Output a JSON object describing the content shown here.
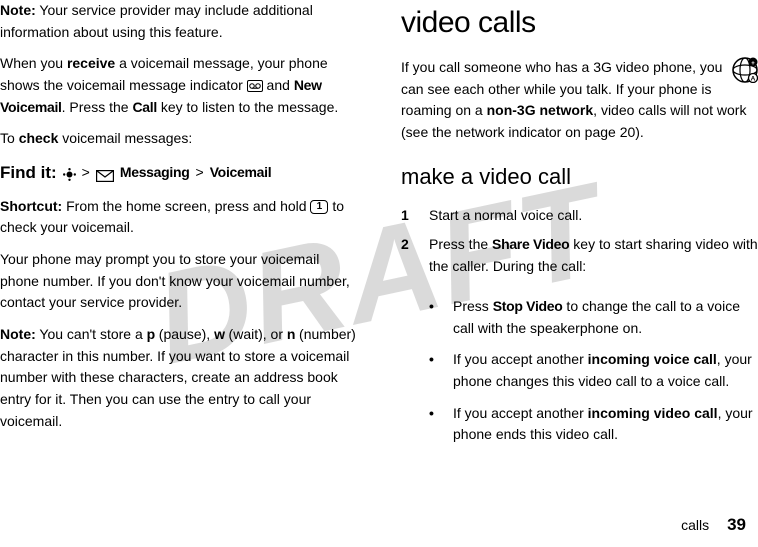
{
  "watermark": "DRAFT",
  "left": {
    "note1_label": "Note:",
    "note1_body": " Your service provider may include additional information about using this feature.",
    "receive_pre": "When you ",
    "receive_bold": "receive",
    "receive_mid": " a voicemail message, your phone shows the voicemail message indicator ",
    "receive_after_icon": " and ",
    "new_voicemail": "New Voicemail",
    "receive_tail1": ". Press the ",
    "call_key": "Call",
    "receive_tail2": " key to listen to the message.",
    "check_pre": "To ",
    "check_bold": "check",
    "check_tail": " voicemail messages:",
    "findit_label": "Find it:",
    "findit_gt1": ">",
    "findit_messaging": "Messaging",
    "findit_gt2": ">",
    "findit_voicemail": "Voicemail",
    "shortcut_label": "Shortcut:",
    "shortcut_body": " From the home screen, press and hold ",
    "shortcut_key": "1",
    "shortcut_tail": " to check your voicemail.",
    "prompt": "Your phone may prompt you to store your voicemail phone number. If you don't know your voicemail number, contact your service provider.",
    "note2_label": "Note:",
    "note2_a": " You can't store a ",
    "p": "p",
    "note2_b": " (pause), ",
    "w": "w",
    "note2_c": " (wait), or ",
    "n": "n",
    "note2_d": " (number) character in this number. If you want to store a voicemail number with these characters, create an address book entry for it. Then you can use the entry to call your voicemail."
  },
  "right": {
    "h1": "video calls",
    "intro_a": "If you call someone who has a 3G video phone, you can see each other while you talk. If your phone is roaming on a ",
    "intro_bold": "non-3G network",
    "intro_b": ", video calls will not work (see the network indicator on page 20).",
    "h2": "make a video call",
    "step1_num": "1",
    "step1_body": "Start a normal voice call.",
    "step2_num": "2",
    "step2_a": "Press the ",
    "share_video": "Share Video",
    "step2_b": " key to start sharing video with the caller. During the call:",
    "bullet1_a": "Press ",
    "stop_video": "Stop Video",
    "bullet1_b": " to change the call to a voice call with the speakerphone on.",
    "bullet2_a": "If you accept another ",
    "bullet2_bold": "incoming voice call",
    "bullet2_b": ", your phone changes this video call to a voice call.",
    "bullet3_a": "If you accept another ",
    "bullet3_bold": "incoming video call",
    "bullet3_b": ", your phone ends this video call."
  },
  "footer": {
    "section": "calls",
    "page": "39"
  }
}
